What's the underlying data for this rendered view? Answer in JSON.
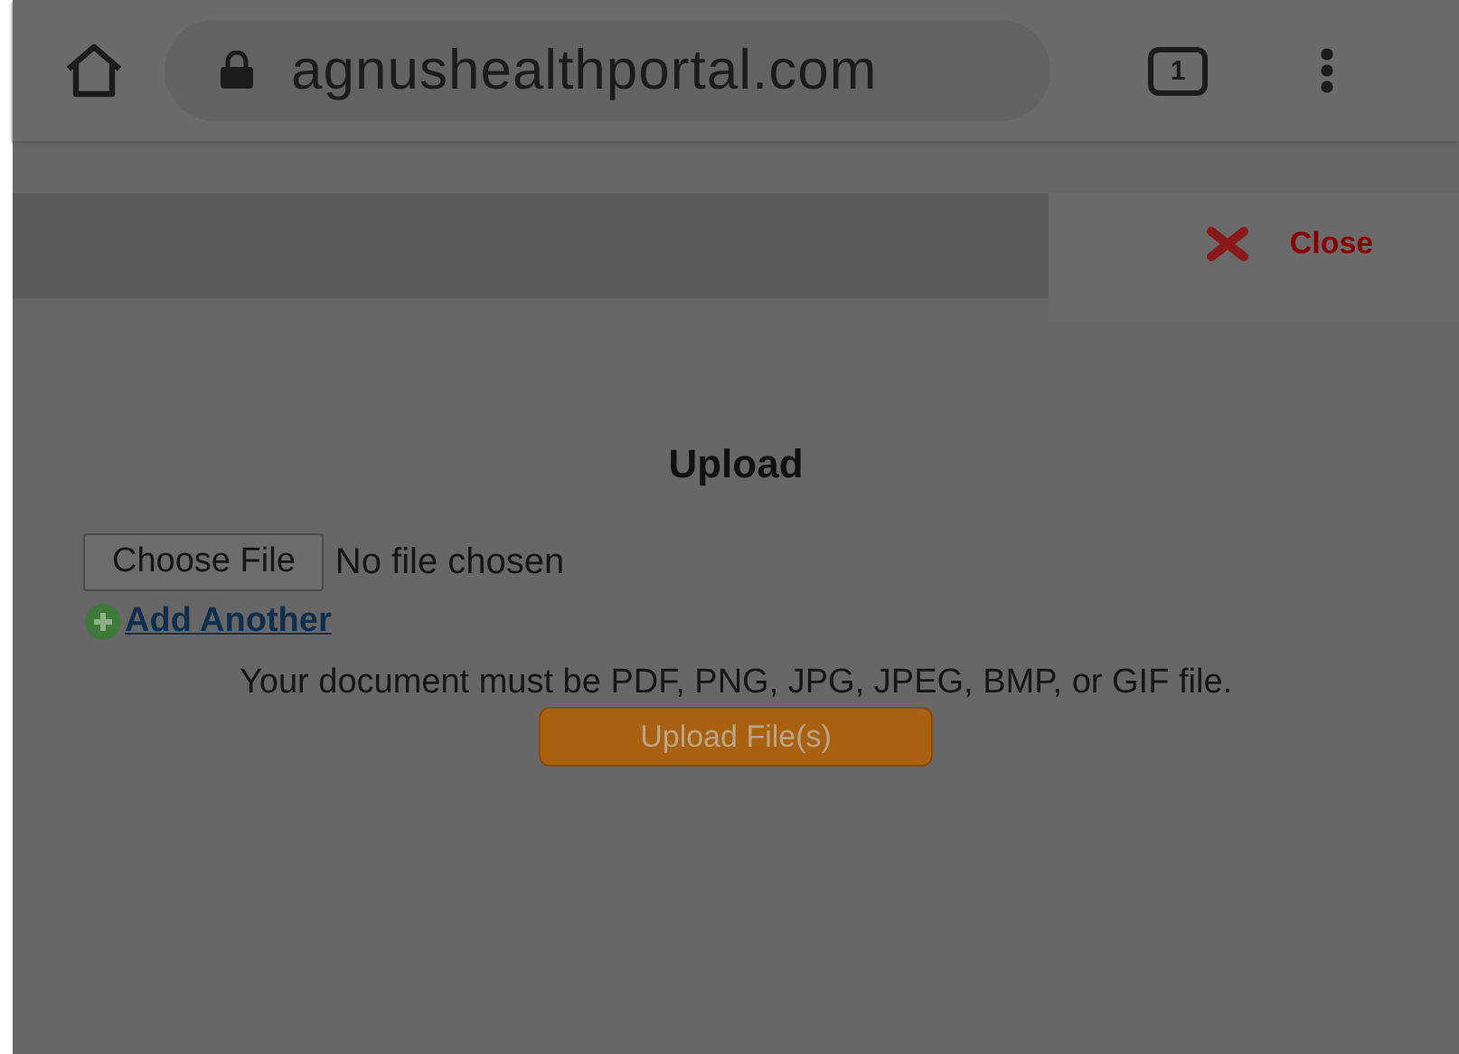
{
  "browser": {
    "url": "agnushealthportal.com",
    "tab_count": "1"
  },
  "dialog": {
    "close": "Close",
    "title": "Upload",
    "choose_file": "Choose File",
    "file_status": "No file chosen",
    "add_another": "Add Another",
    "notice": "Your document must be PDF, PNG, JPG, JPEG, BMP, or GIF file.",
    "upload_button": "Upload File(s)"
  }
}
